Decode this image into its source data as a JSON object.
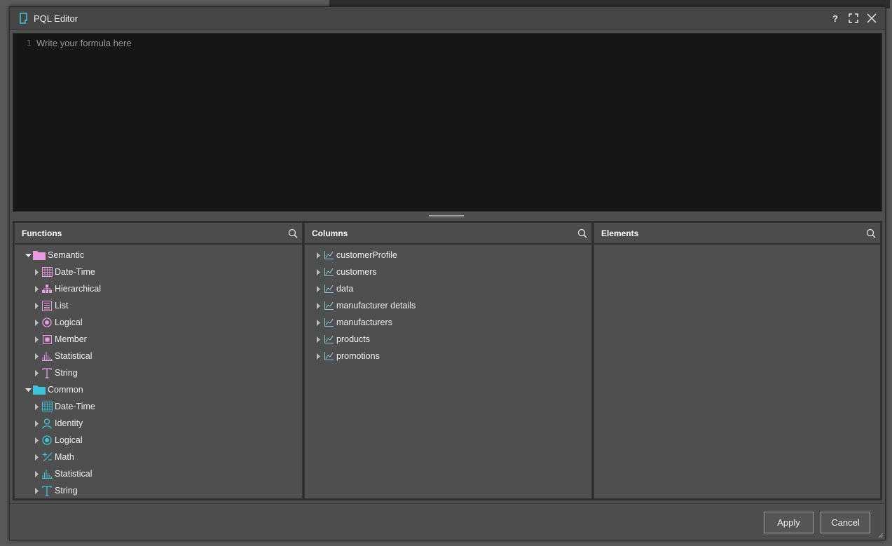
{
  "window": {
    "title": "PQL Editor"
  },
  "title_actions": {
    "help": "?"
  },
  "editor": {
    "line_number": "1",
    "placeholder": "Write your formula here"
  },
  "panels": {
    "functions": {
      "title": "Functions",
      "groups": [
        {
          "label": "Semantic",
          "color": "#e89be0",
          "items": [
            {
              "label": "Date-Time",
              "icon": "calendar-icon"
            },
            {
              "label": "Hierarchical",
              "icon": "hierarchy-icon"
            },
            {
              "label": "List",
              "icon": "list-icon"
            },
            {
              "label": "Logical",
              "icon": "logical-icon"
            },
            {
              "label": "Member",
              "icon": "member-icon"
            },
            {
              "label": "Statistical",
              "icon": "statistical-icon"
            },
            {
              "label": "String",
              "icon": "string-icon"
            }
          ]
        },
        {
          "label": "Common",
          "color": "#3ec4d8",
          "items": [
            {
              "label": "Date-Time",
              "icon": "calendar-icon"
            },
            {
              "label": "Identity",
              "icon": "identity-icon"
            },
            {
              "label": "Logical",
              "icon": "logical-icon"
            },
            {
              "label": "Math",
              "icon": "math-icon"
            },
            {
              "label": "Statistical",
              "icon": "statistical-icon"
            },
            {
              "label": "String",
              "icon": "string-icon"
            }
          ]
        }
      ]
    },
    "columns": {
      "title": "Columns",
      "items": [
        "customerProfile",
        "customers",
        "data",
        "manufacturer details",
        "manufacturers",
        "products",
        "promotions"
      ]
    },
    "elements": {
      "title": "Elements",
      "items": []
    }
  },
  "footer": {
    "apply_label": "Apply",
    "cancel_label": "Cancel"
  },
  "colors": {
    "accent_teal": "#3ec4d8",
    "semantic_pink": "#e89be0",
    "column_icon": "#8fc7dd"
  }
}
